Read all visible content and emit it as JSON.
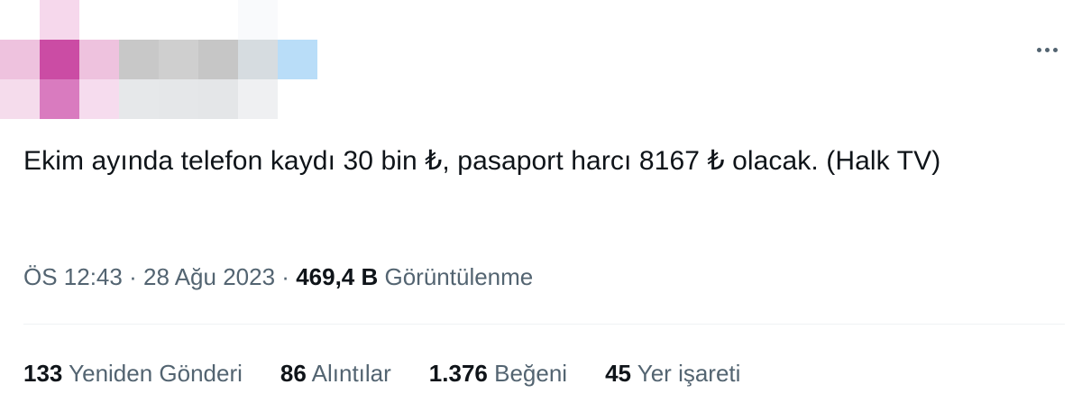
{
  "avatar": {
    "pixels": [
      [
        "#ffffff",
        "#f6d8ec",
        "#ffffff",
        "#ffffff",
        "#ffffff",
        "#ffffff",
        "#f9fafc",
        "#ffffff"
      ],
      [
        "#eec2de",
        "#cb4ca4",
        "#eec2de",
        "#c8c8c8",
        "#cfcfcf",
        "#c6c6c6",
        "#d6dce0",
        "#b9ddf8"
      ],
      [
        "#f5dcec",
        "#d97bbf",
        "#f6dcee",
        "#e6e8ea",
        "#e5e7e9",
        "#e4e6e8",
        "#eff0f2",
        "#ffffff"
      ]
    ]
  },
  "menu": {
    "icon": "more-horizontal-icon"
  },
  "tweet": {
    "text": "Ekim ayında telefon kaydı 30 bin ₺, pasaport harcı 8167 ₺ olacak. (Halk TV)",
    "time": "ÖS 12:43",
    "separator": "·",
    "date": "28 Ağu 2023",
    "views_count": "469,4 B",
    "views_label": "Görüntülenme"
  },
  "stats": [
    {
      "count": "133",
      "label": "Yeniden Gönderi"
    },
    {
      "count": "86",
      "label": "Alıntılar"
    },
    {
      "count": "1.376",
      "label": "Beğeni"
    },
    {
      "count": "45",
      "label": "Yer işareti"
    }
  ],
  "colors": {
    "text_primary": "#0f1419",
    "text_secondary": "#536471",
    "divider": "#eff3f4"
  }
}
